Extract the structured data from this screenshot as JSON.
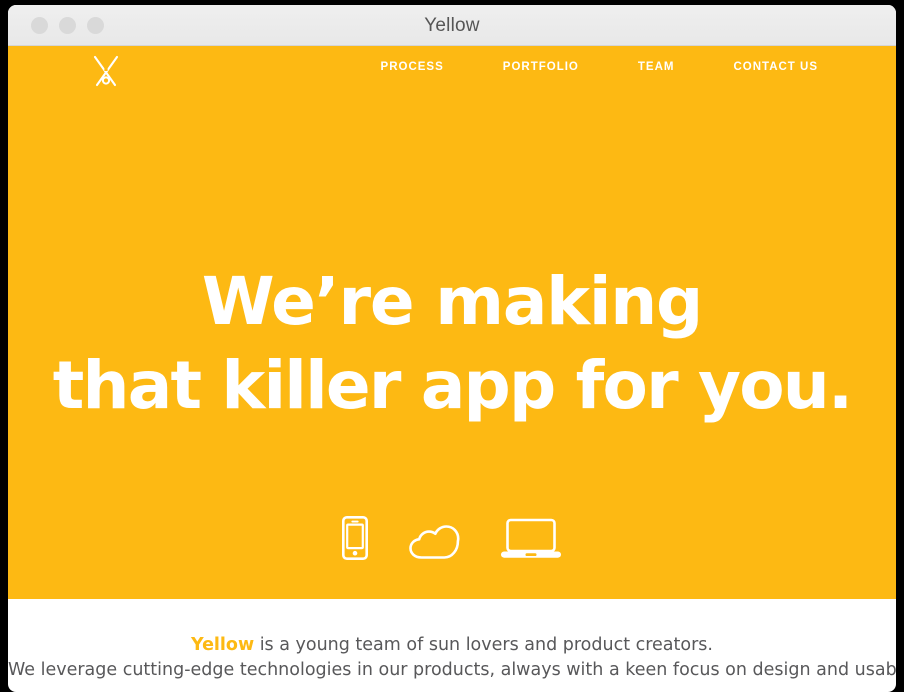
{
  "window": {
    "title": "Yellow",
    "controls": [
      "close",
      "minimize",
      "maximize"
    ]
  },
  "site": {
    "logo_name": "yellow-logo-mark",
    "nav": [
      {
        "label": "PROCESS"
      },
      {
        "label": "PORTFOLIO"
      },
      {
        "label": "TEAM"
      },
      {
        "label": "CONTACT US"
      }
    ],
    "hero": {
      "headline_line1": "We’re making",
      "headline_line2": "that killer app for you.",
      "devices": [
        {
          "icon": "smartphone-icon"
        },
        {
          "icon": "cloud-icon"
        },
        {
          "icon": "laptop-icon"
        }
      ]
    },
    "intro": {
      "brand": "Yellow",
      "line1_rest": " is a young team of sun lovers and product creators.",
      "line2": "We leverage cutting-edge technologies in our products, always with a keen focus on design and usability."
    }
  },
  "colors": {
    "brand_yellow": "#FDB913",
    "hero_text": "#FFFFFF",
    "body_text": "#58585A",
    "titlebar": "#EDEDED",
    "traffic_light": "#D9D9D9"
  }
}
